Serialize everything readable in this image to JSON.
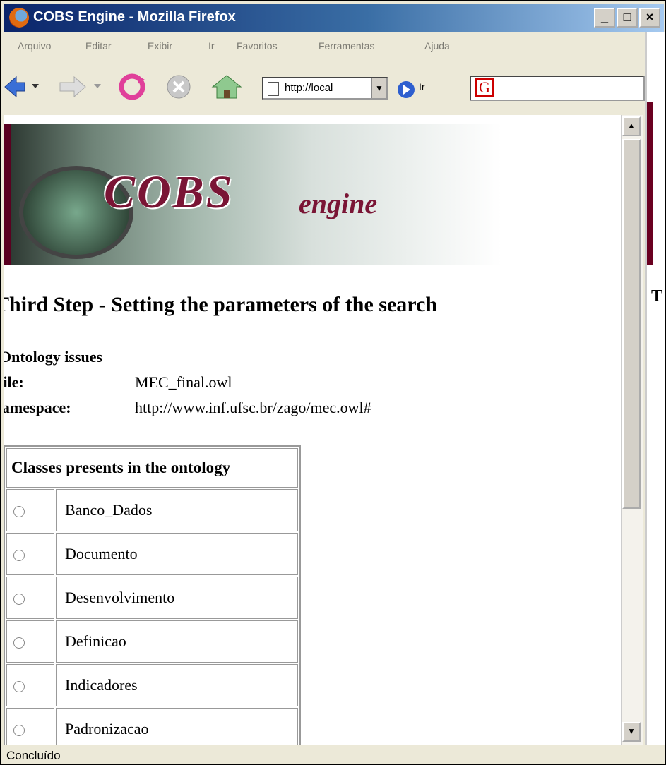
{
  "window": {
    "title": "COBS Engine - Mozilla Firefox",
    "controls": [
      "_",
      "□",
      "×"
    ]
  },
  "menubar": {
    "items": [
      "Arquivo",
      "Editar",
      "Exibir",
      "Ir",
      "Favoritos",
      "Ferramentas",
      "Ajuda"
    ]
  },
  "toolbar": {
    "url": "http://local",
    "go_label": "Ir",
    "search_engine_icon": "G",
    "buttons": [
      "back-icon",
      "forward-icon",
      "reload-icon",
      "stop-icon",
      "home-icon"
    ]
  },
  "page": {
    "banner": {
      "title": "COBS",
      "subtitle": "engine"
    },
    "heading": "Third Step - Setting the parameters of the search",
    "ontology": {
      "section_title": "Ontology issues",
      "file_label": "File:",
      "file_value": "MEC_final.owl",
      "namespace_label": "Namespace:",
      "namespace_value": "http://www.inf.ufsc.br/zago/mec.owl#"
    },
    "classes_table": {
      "header": "Classes presents in the ontology",
      "rows": [
        "Banco_Dados",
        "Documento",
        "Desenvolvimento",
        "Definicao",
        "Indicadores",
        "Padronizacao"
      ]
    }
  },
  "status": {
    "text": "Concluído"
  }
}
